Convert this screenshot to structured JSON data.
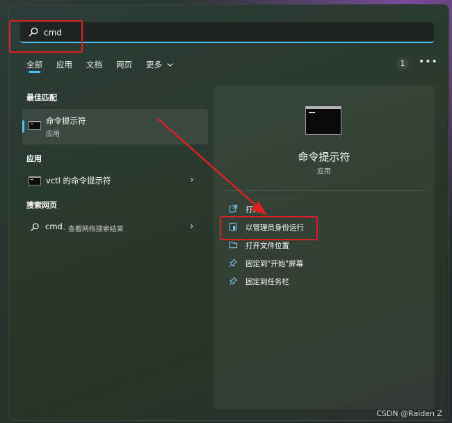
{
  "search": {
    "value": "cmd"
  },
  "tabs": [
    {
      "label": "全部"
    },
    {
      "label": "应用"
    },
    {
      "label": "文档"
    },
    {
      "label": "网页"
    },
    {
      "label": "更多"
    }
  ],
  "header": {
    "badge": "1",
    "more_options": "•••"
  },
  "best_match": {
    "section_title": "最佳匹配",
    "title": "命令提示符",
    "subtitle": "应用"
  },
  "apps": {
    "section_title": "应用",
    "items": [
      {
        "label": "vctl 的命令提示符"
      }
    ]
  },
  "web": {
    "section_title": "搜索网页",
    "query": "cmd",
    "suffix": " - 查看网络搜索结果"
  },
  "detail": {
    "title": "命令提示符",
    "subtitle": "应用",
    "actions": [
      {
        "label": "打开",
        "icon": "open-external-icon"
      },
      {
        "label": "以管理员身份运行",
        "icon": "admin-shield-icon"
      },
      {
        "label": "打开文件位置",
        "icon": "folder-icon"
      },
      {
        "label": "固定到\"开始\"屏幕",
        "icon": "pin-icon"
      },
      {
        "label": "固定到任务栏",
        "icon": "pin-icon"
      }
    ]
  },
  "watermark": "CSDN @Raiden Z",
  "colors": {
    "accent": "#4cc2ff",
    "annotation": "#e02020"
  }
}
